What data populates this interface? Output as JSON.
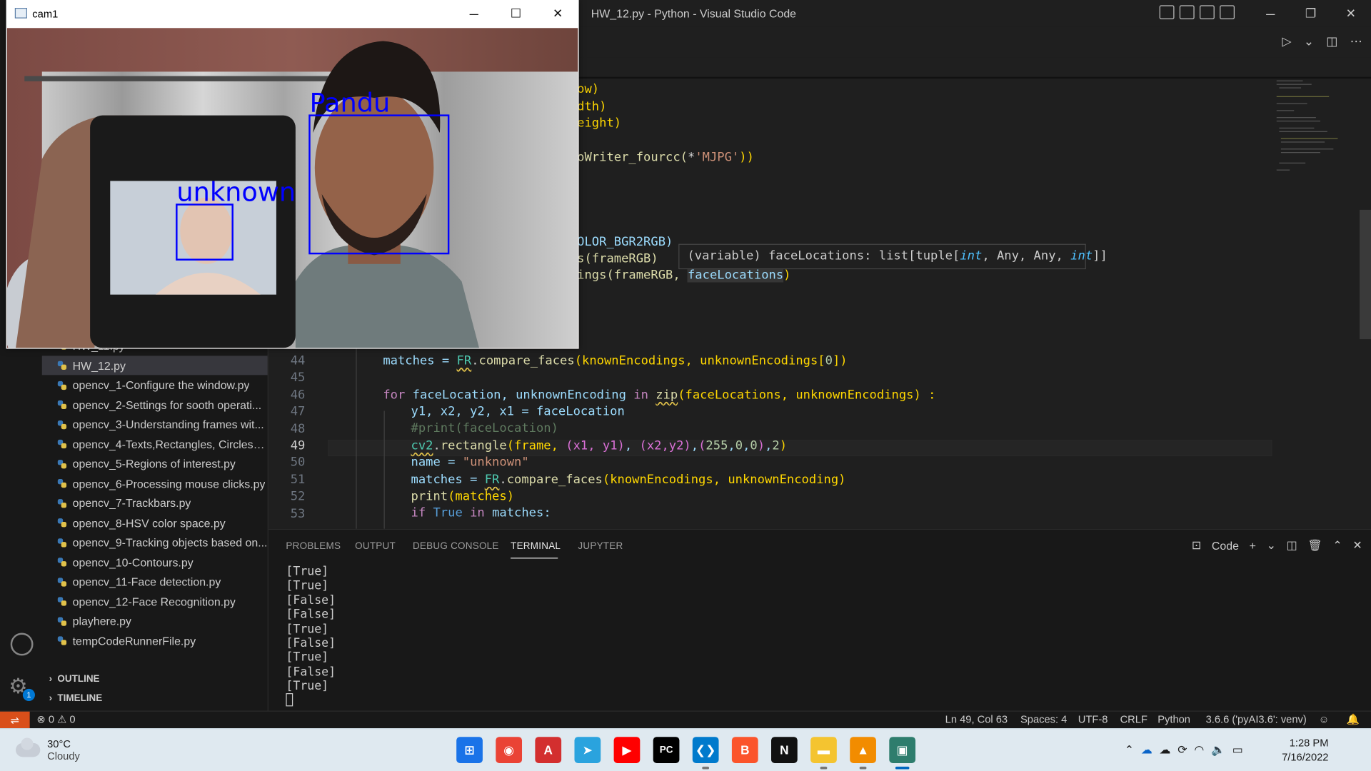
{
  "vscode": {
    "title": "HW_12.py - Python - Visual Studio Code",
    "editor_lines": [
      {
        "ln": "44",
        "active": false
      },
      {
        "ln": "45",
        "active": false
      },
      {
        "ln": "46",
        "active": false
      },
      {
        "ln": "47",
        "active": false
      },
      {
        "ln": "48",
        "active": false
      },
      {
        "ln": "49",
        "active": true
      },
      {
        "ln": "50",
        "active": false
      },
      {
        "ln": "51",
        "active": false
      },
      {
        "ln": "52",
        "active": false
      },
      {
        "ln": "53",
        "active": false
      }
    ],
    "code_fragments": {
      "frag1": "ow)",
      "frag2": "dth)",
      "frag3": "eight)",
      "frag4a": "oWriter_fourcc(",
      "frag4b": "*",
      "frag4c": "'MJPG'",
      "frag4d": "))",
      "frag5": "OLOR_BGR2RGB)",
      "frag6": "s(frameRGB)",
      "frag7a": "ings(frameRGB, ",
      "frag7b": "faceLocations",
      "frag7c": ")"
    },
    "hover": {
      "prefix": "(variable) faceLocations: list[tuple[",
      "int1": "int",
      "mid": ", Any, Any, ",
      "int2": "int",
      "suffix": "]]"
    },
    "code": {
      "l44": {
        "a": "matches = ",
        "b": "FR",
        "c": ".",
        "d": "compare_faces",
        "e": "(knownEncodings, unknownEncodings[",
        "f": "0",
        "g": "])"
      },
      "l46": {
        "for": "for",
        "a": " faceLocation, unknownEncoding ",
        "in": "in",
        "sp": " ",
        "zip": "zip",
        "b": "(faceLocations, unknownEncodings) :"
      },
      "l47": "y1, x2, y2, x1 = faceLocation",
      "l48": "#print(faceLocation)",
      "l49": {
        "cv2": "cv2",
        "dot": ".",
        "rect": "rectangle",
        "a": "(frame, ",
        "b": "(x1, y1)",
        "c": ", ",
        "d": "(x2,y2)",
        "e": ",",
        "f": "(",
        "n1": "255",
        "k1": ",",
        "n2": "0",
        "k2": ",",
        "n3": "0",
        "g": ")",
        "h": ",",
        "n4": "2",
        "i": ")"
      },
      "l50": {
        "a": "name = ",
        "s": "\"unknown\""
      },
      "l51": {
        "a": "matches = ",
        "b": "FR",
        "c": ".",
        "d": "compare_faces",
        "e": "(knownEncodings, unknownEncoding)"
      },
      "l52": {
        "p": "print",
        "a": "(matches)"
      },
      "l53": {
        "if": "if",
        "sp": " ",
        "t": "True",
        "sp2": " ",
        "in": "in",
        "a": " matches:"
      }
    }
  },
  "explorer": {
    "partial_top": "HW_11.py",
    "files": [
      {
        "name": "HW_12.py",
        "selected": true
      },
      {
        "name": "opencv_1-Configure the window.py",
        "selected": false
      },
      {
        "name": "opencv_2-Settings for sooth operati...",
        "selected": false
      },
      {
        "name": "opencv_3-Understanding frames wit...",
        "selected": false
      },
      {
        "name": "opencv_4-Texts,Rectangles, Circles.py",
        "selected": false
      },
      {
        "name": "opencv_5-Regions of interest.py",
        "selected": false
      },
      {
        "name": "opencv_6-Processing mouse clicks.py",
        "selected": false
      },
      {
        "name": "opencv_7-Trackbars.py",
        "selected": false
      },
      {
        "name": "opencv_8-HSV color space.py",
        "selected": false
      },
      {
        "name": "opencv_9-Tracking objects based on...",
        "selected": false
      },
      {
        "name": "opencv_10-Contours.py",
        "selected": false
      },
      {
        "name": "opencv_11-Face detection.py",
        "selected": false
      },
      {
        "name": "opencv_12-Face Recognition.py",
        "selected": false
      },
      {
        "name": "playhere.py",
        "selected": false
      },
      {
        "name": "tempCodeRunnerFile.py",
        "selected": false
      }
    ],
    "outline": "OUTLINE",
    "timeline": "TIMELINE",
    "settings_badge": "1"
  },
  "panel": {
    "tabs": [
      "PROBLEMS",
      "OUTPUT",
      "DEBUG CONSOLE",
      "TERMINAL",
      "JUPYTER"
    ],
    "active_tab": "TERMINAL",
    "shell_label": "Code",
    "terminal_lines": [
      "[True]",
      "[True]",
      "[False]",
      "[False]",
      "[True]",
      "[False]",
      "[True]",
      "[False]",
      "[True]"
    ]
  },
  "statusbar": {
    "errors": "0",
    "warnings": "0",
    "position": "Ln 49, Col 63",
    "spaces": "Spaces: 4",
    "encoding": "UTF-8",
    "eol": "CRLF",
    "language": "Python",
    "interpreter": "3.6.6 ('pyAI3.6': venv)"
  },
  "cam_window": {
    "title": "cam1",
    "label_known": "Pandu",
    "label_unknown": "unknown",
    "box_color": "#0000ff"
  },
  "taskbar": {
    "temperature": "30°C",
    "condition": "Cloudy",
    "time": "1:28 PM",
    "date": "7/16/2022",
    "apps": [
      {
        "icon": "windows-start-icon",
        "color": "#1a73e8"
      },
      {
        "icon": "chrome-icon",
        "color": "#ea4335"
      },
      {
        "icon": "acrobat-icon",
        "color": "#d32f2f"
      },
      {
        "icon": "telegram-icon",
        "color": "#2aa3de"
      },
      {
        "icon": "youtube-icon",
        "color": "#ff0000"
      },
      {
        "icon": "pycharm-icon",
        "color": "#000000"
      },
      {
        "icon": "vscode-icon",
        "color": "#007acc"
      },
      {
        "icon": "brave-icon",
        "color": "#fb542b"
      },
      {
        "icon": "notion-icon",
        "color": "#111111"
      },
      {
        "icon": "file-explorer-icon",
        "color": "#f4c430"
      },
      {
        "icon": "vlc-icon",
        "color": "#f28c00"
      },
      {
        "icon": "cam-window-icon",
        "color": "#2e7d6d"
      }
    ]
  }
}
